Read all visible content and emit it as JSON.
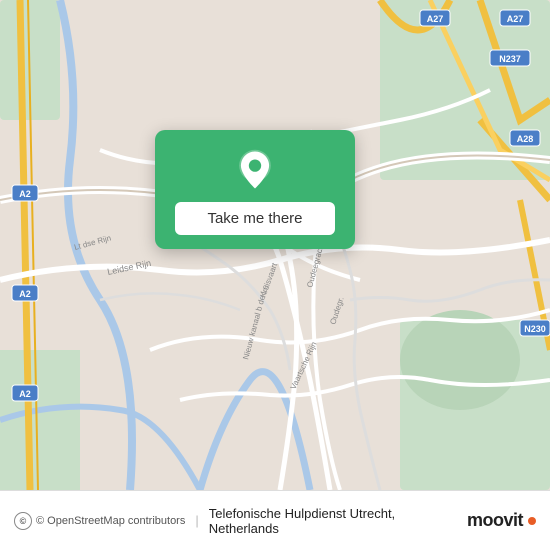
{
  "map": {
    "attribution": "© OpenStreetMap contributors",
    "background_color": "#e8e0d8"
  },
  "popup": {
    "button_label": "Take me there",
    "pin_icon": "location-pin-icon",
    "background_color": "#3cb371"
  },
  "bottom_bar": {
    "osm_label": "© OpenStreetMap contributors",
    "location_name": "Telefonische Hulpdienst Utrecht, Netherlands",
    "moovit_label": "moovit"
  }
}
